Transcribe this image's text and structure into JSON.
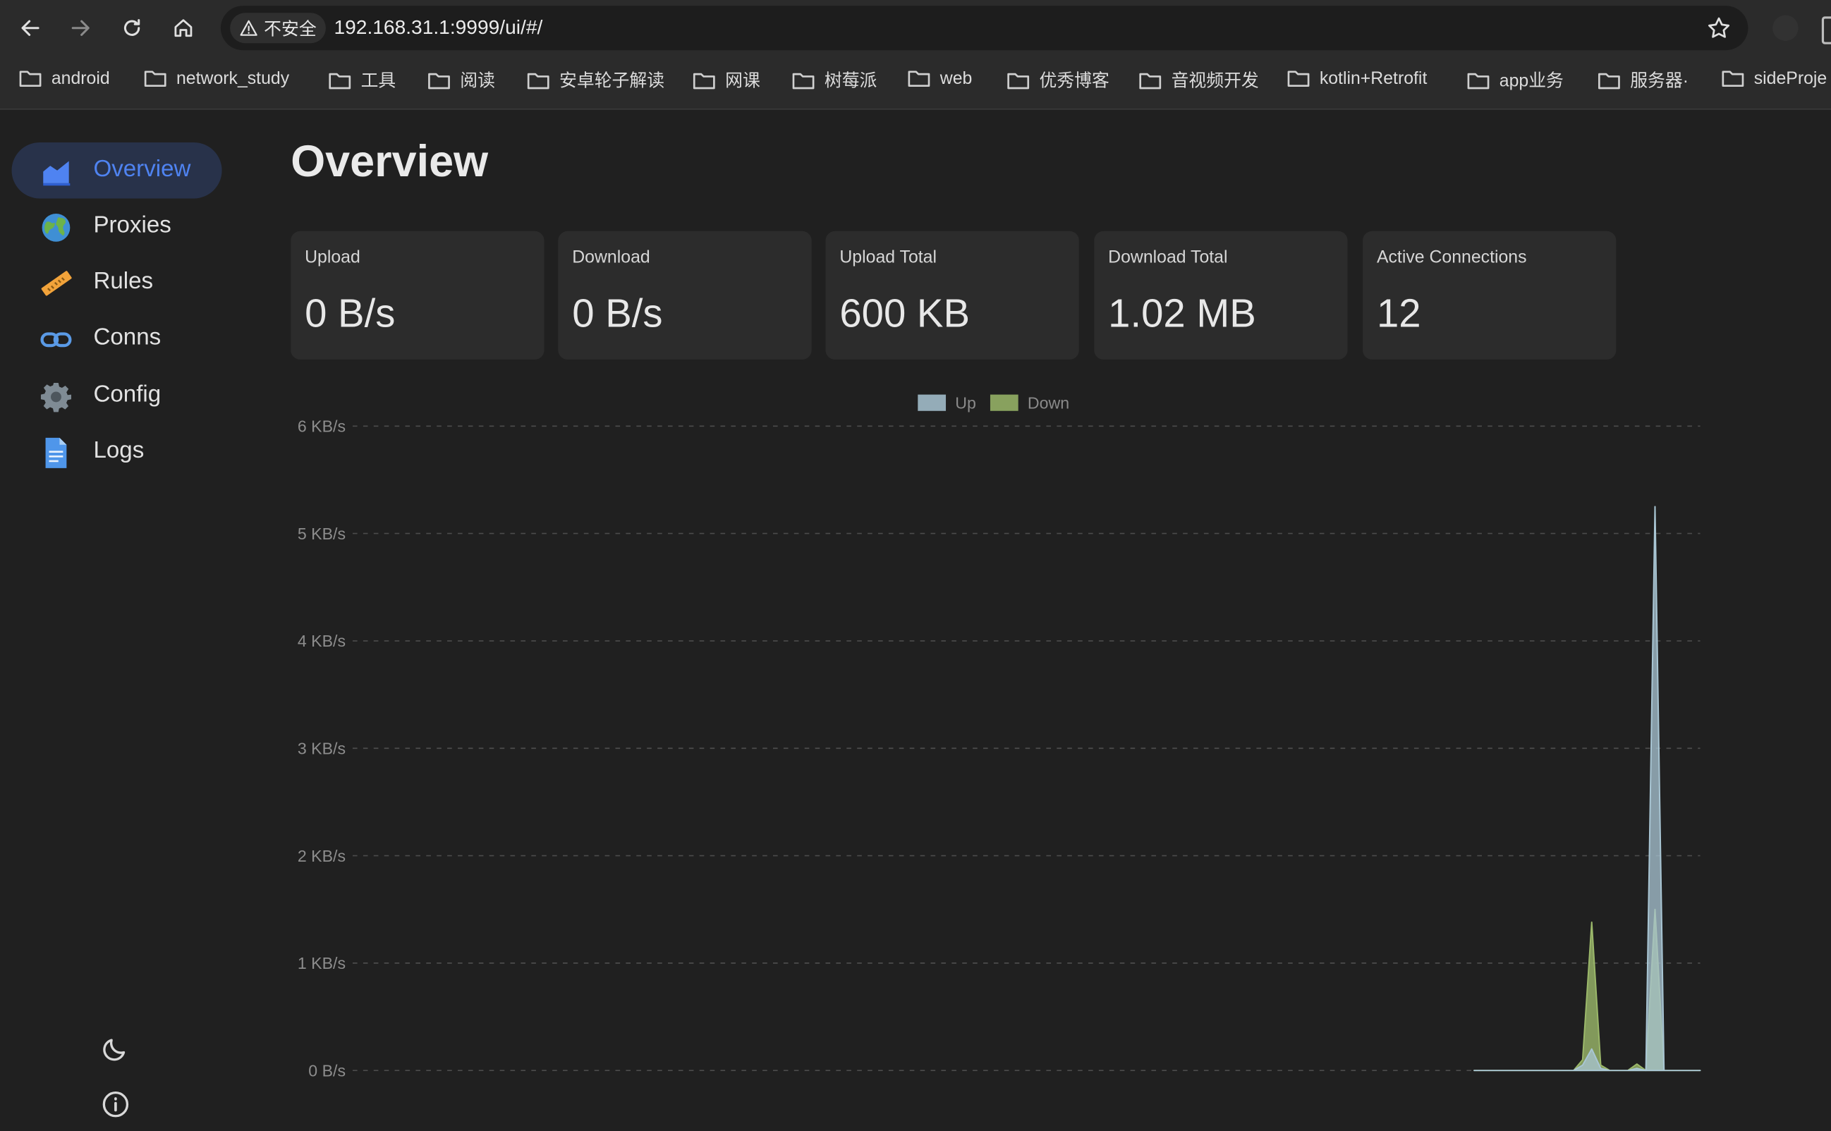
{
  "browser": {
    "security_label": "不安全",
    "url": "192.168.31.1:9999/ui/#/",
    "bookmarks": [
      "android",
      "network_study",
      "工具",
      "阅读",
      "安卓轮子解读",
      "网课",
      "树莓派",
      "web",
      "优秀博客",
      "音视频开发",
      "kotlin+Retrofit",
      "app业务",
      "服务器·",
      "sideProje"
    ]
  },
  "sidebar": {
    "items": [
      {
        "label": "Overview",
        "icon": "chart-area-icon",
        "active": true
      },
      {
        "label": "Proxies",
        "icon": "globe-icon",
        "active": false
      },
      {
        "label": "Rules",
        "icon": "ruler-icon",
        "active": false
      },
      {
        "label": "Conns",
        "icon": "link-icon",
        "active": false
      },
      {
        "label": "Config",
        "icon": "gear-icon",
        "active": false
      },
      {
        "label": "Logs",
        "icon": "document-icon",
        "active": false
      }
    ],
    "bottom_icons": [
      "moon-icon",
      "info-icon"
    ]
  },
  "main": {
    "title": "Overview",
    "stats": [
      {
        "label": "Upload",
        "value": "0 B/s"
      },
      {
        "label": "Download",
        "value": "0 B/s"
      },
      {
        "label": "Upload Total",
        "value": "600 KB"
      },
      {
        "label": "Download Total",
        "value": "1.02 MB"
      },
      {
        "label": "Active Connections",
        "value": "12"
      }
    ]
  },
  "colors": {
    "accent": "#4f83f1",
    "up": "#a9c6d4",
    "down": "#9bb86a",
    "background": "#202020",
    "card": "#2c2c2c"
  },
  "chart_data": {
    "type": "area",
    "title": "",
    "legend": [
      "Up",
      "Down"
    ],
    "legend_position": "top-center",
    "y_ticks": [
      "0 B/s",
      "1 KB/s",
      "2 KB/s",
      "3 KB/s",
      "4 KB/s",
      "5 KB/s",
      "6 KB/s"
    ],
    "ylim": [
      0,
      6
    ],
    "yunit": "KB/s",
    "grid": "dashed horizontal",
    "x": [
      0,
      1,
      2,
      3,
      4,
      5,
      6,
      7,
      8,
      9,
      10,
      11,
      12,
      13,
      14,
      15,
      16,
      17,
      18,
      19,
      20,
      21,
      22,
      23,
      24,
      25,
      26,
      27,
      28,
      29,
      30,
      31,
      32,
      33,
      34,
      35,
      36,
      37,
      38,
      39,
      40,
      41,
      42,
      43,
      44,
      45,
      46,
      47,
      48,
      49,
      50,
      51,
      52,
      53,
      54,
      55,
      56,
      57,
      58,
      59,
      60,
      61,
      62,
      63,
      64,
      65,
      66,
      67,
      68,
      69,
      70,
      71,
      72,
      73,
      74,
      75,
      76,
      77,
      78,
      79,
      80,
      81,
      82,
      83,
      84,
      85,
      86,
      87,
      88,
      89,
      90,
      91,
      92,
      93,
      94,
      95,
      96,
      97,
      98,
      99,
      100,
      101,
      102,
      103,
      104,
      105,
      106,
      107,
      108,
      109,
      110,
      111,
      112,
      113,
      114,
      115,
      116,
      117,
      118,
      119,
      120,
      121,
      122,
      123,
      124,
      125,
      126,
      127,
      128,
      129,
      130,
      131,
      132,
      133,
      134,
      135,
      136,
      137,
      138,
      139,
      140,
      141,
      142,
      143,
      144,
      145,
      146,
      147,
      148,
      149
    ],
    "series": [
      {
        "name": "Up",
        "values": [
          null,
          null,
          null,
          null,
          null,
          null,
          null,
          null,
          null,
          null,
          null,
          null,
          null,
          null,
          null,
          null,
          null,
          null,
          null,
          null,
          null,
          null,
          null,
          null,
          null,
          null,
          null,
          null,
          null,
          null,
          null,
          null,
          null,
          null,
          null,
          null,
          null,
          null,
          null,
          null,
          null,
          null,
          null,
          null,
          null,
          null,
          null,
          null,
          null,
          null,
          null,
          null,
          null,
          null,
          null,
          null,
          null,
          null,
          null,
          null,
          null,
          null,
          null,
          null,
          null,
          null,
          null,
          null,
          null,
          null,
          null,
          null,
          null,
          null,
          null,
          null,
          null,
          null,
          null,
          null,
          null,
          null,
          null,
          null,
          null,
          null,
          null,
          null,
          null,
          null,
          null,
          null,
          null,
          null,
          null,
          null,
          null,
          null,
          null,
          null,
          null,
          null,
          null,
          null,
          null,
          null,
          null,
          null,
          null,
          null,
          null,
          null,
          null,
          null,
          null,
          null,
          null,
          null,
          null,
          null,
          null,
          null,
          null,
          null,
          0,
          0,
          0,
          0,
          0,
          0,
          0,
          0,
          0,
          0,
          0,
          0,
          0.05,
          0.2,
          0.02,
          0,
          0,
          0,
          0.02,
          0,
          5.25,
          0,
          0,
          0,
          0,
          0,
          0
        ]
      },
      {
        "name": "Down",
        "values": [
          null,
          null,
          null,
          null,
          null,
          null,
          null,
          null,
          null,
          null,
          null,
          null,
          null,
          null,
          null,
          null,
          null,
          null,
          null,
          null,
          null,
          null,
          null,
          null,
          null,
          null,
          null,
          null,
          null,
          null,
          null,
          null,
          null,
          null,
          null,
          null,
          null,
          null,
          null,
          null,
          null,
          null,
          null,
          null,
          null,
          null,
          null,
          null,
          null,
          null,
          null,
          null,
          null,
          null,
          null,
          null,
          null,
          null,
          null,
          null,
          null,
          null,
          null,
          null,
          null,
          null,
          null,
          null,
          null,
          null,
          null,
          null,
          null,
          null,
          null,
          null,
          null,
          null,
          null,
          null,
          null,
          null,
          null,
          null,
          null,
          null,
          null,
          null,
          null,
          null,
          null,
          null,
          null,
          null,
          null,
          null,
          null,
          null,
          null,
          null,
          null,
          null,
          null,
          null,
          null,
          null,
          null,
          null,
          null,
          null,
          null,
          null,
          null,
          null,
          null,
          null,
          null,
          null,
          null,
          null,
          null,
          null,
          null,
          null,
          0,
          0,
          0,
          0,
          0,
          0,
          0,
          0,
          0,
          0,
          0,
          0,
          0.1,
          1.38,
          0.05,
          0,
          0,
          0,
          0.06,
          0,
          1.5,
          0,
          0,
          0,
          0,
          0,
          0
        ]
      }
    ]
  }
}
